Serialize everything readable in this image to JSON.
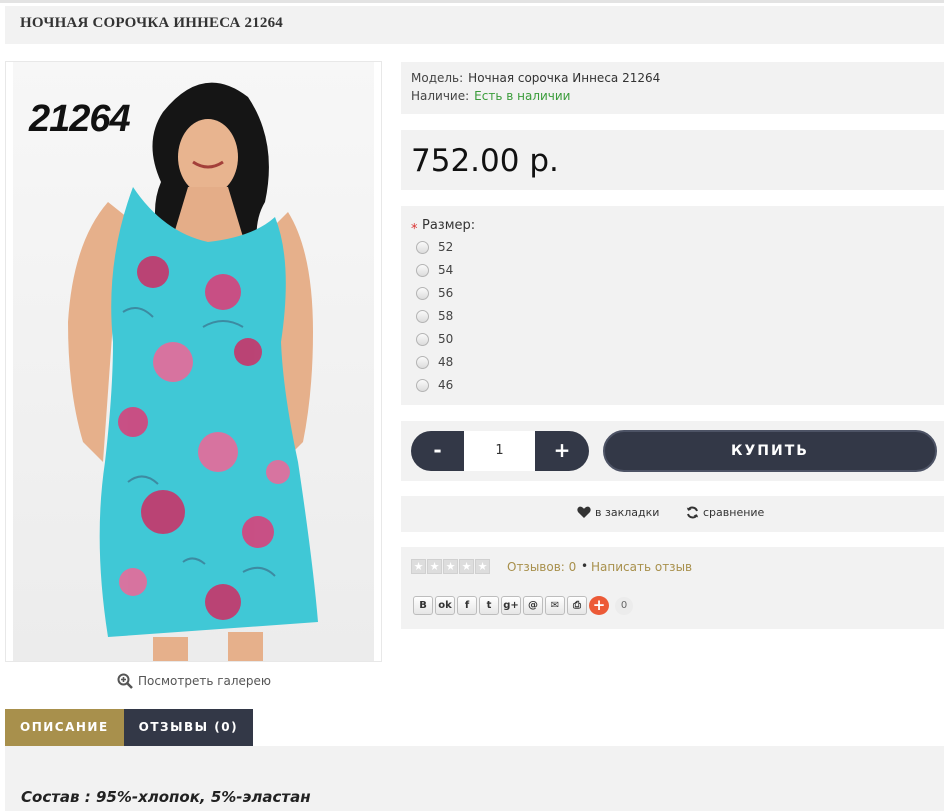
{
  "product": {
    "title": "НОЧНАЯ СОРОЧКА ИННЕСА 21264",
    "image_label": "21264",
    "gallery_link": "Посмотреть галерею",
    "model_label": "Модель:",
    "model_value": "Ночная сорочка Иннеса 21264",
    "availability_label": "Наличие:",
    "availability_value": "Есть в наличии",
    "price": "752.00 р."
  },
  "options": {
    "required_mark": "*",
    "size_label": "Размер:",
    "sizes": [
      "52",
      "54",
      "56",
      "58",
      "50",
      "48",
      "46"
    ]
  },
  "purchase": {
    "minus": "-",
    "quantity": "1",
    "plus": "+",
    "buy_label": "КУПИТЬ"
  },
  "actions": {
    "bookmark_label": "в закладки",
    "compare_label": "сравнение"
  },
  "reviews": {
    "rating": 0,
    "max_rating": 5,
    "count_label": "Отзывов: 0",
    "separator": "•",
    "write_label": "Написать отзыв"
  },
  "share": {
    "buttons": [
      {
        "icon": "vk-icon",
        "glyph": "B"
      },
      {
        "icon": "odnoklassniki-icon",
        "glyph": "ok"
      },
      {
        "icon": "facebook-icon",
        "glyph": "f"
      },
      {
        "icon": "twitter-icon",
        "glyph": "t"
      },
      {
        "icon": "google-plus-icon",
        "glyph": "g+"
      },
      {
        "icon": "mail-ru-icon",
        "glyph": "@"
      },
      {
        "icon": "email-icon",
        "glyph": "✉"
      },
      {
        "icon": "print-icon",
        "glyph": "⎙"
      },
      {
        "icon": "more-share-icon",
        "glyph": "+"
      }
    ],
    "count": "0"
  },
  "tabs": [
    {
      "label": "ОПИСАНИЕ"
    },
    {
      "label": "ОТЗЫВЫ (0)"
    }
  ],
  "description": "Состав : 95%-хлопок, 5%-эластан",
  "colors": {
    "dark": "#333847",
    "accent": "#a8904c",
    "in_stock": "#3a9c3a",
    "panel": "#f2f2f2",
    "required": "#d9302f"
  }
}
